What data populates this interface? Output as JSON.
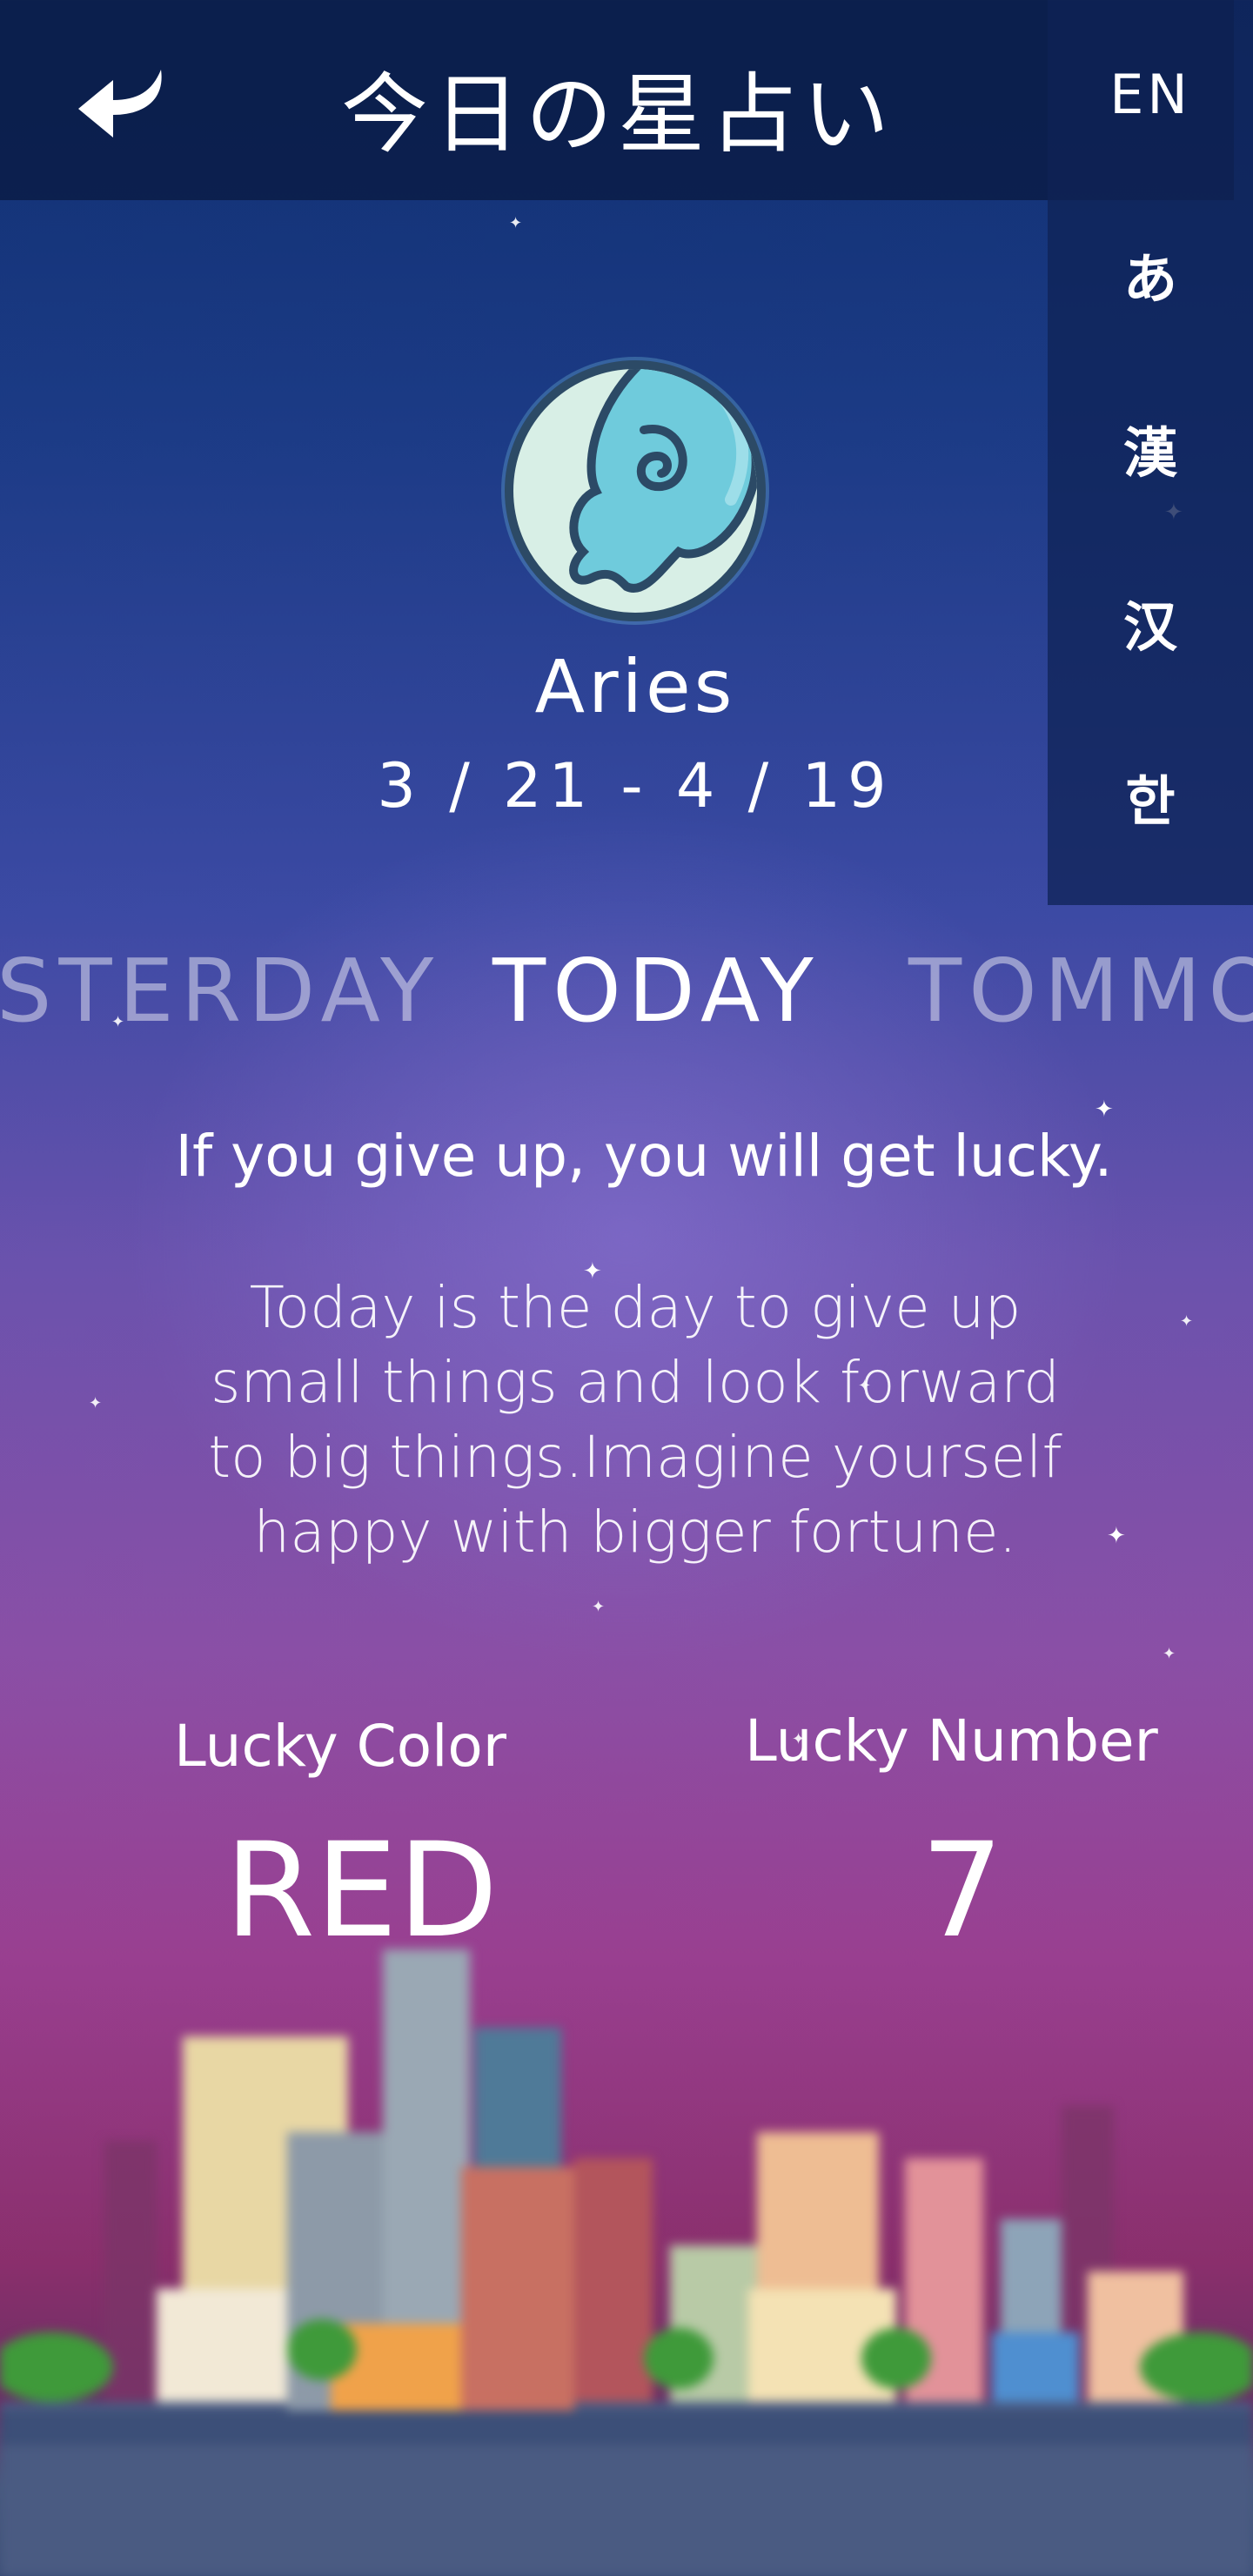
{
  "header": {
    "title": "今日の星占い",
    "back_icon": "back-arrow-icon"
  },
  "languages": [
    "EN",
    "あ",
    "漢",
    "汉",
    "한"
  ],
  "sign": {
    "name": "Aries",
    "dates": "3 / 21 - 4 / 19",
    "icon": "ram-icon"
  },
  "tabs": {
    "yesterday": "STERDAY",
    "today": "TODAY",
    "tomorrow": "TOMMO"
  },
  "fortune": {
    "headline": "If you give up, you will get lucky.",
    "lines": [
      "Today is the day to give up",
      "small things and look forward",
      "to big things.Imagine yourself",
      "happy with bigger fortune."
    ]
  },
  "lucky": {
    "color_label": "Lucky Color",
    "color_value": "RED",
    "number_label": "Lucky Number",
    "number_value": "7"
  },
  "colors": {
    "header_bg": "#0f2a5e",
    "accent": "#8fd0dd"
  }
}
